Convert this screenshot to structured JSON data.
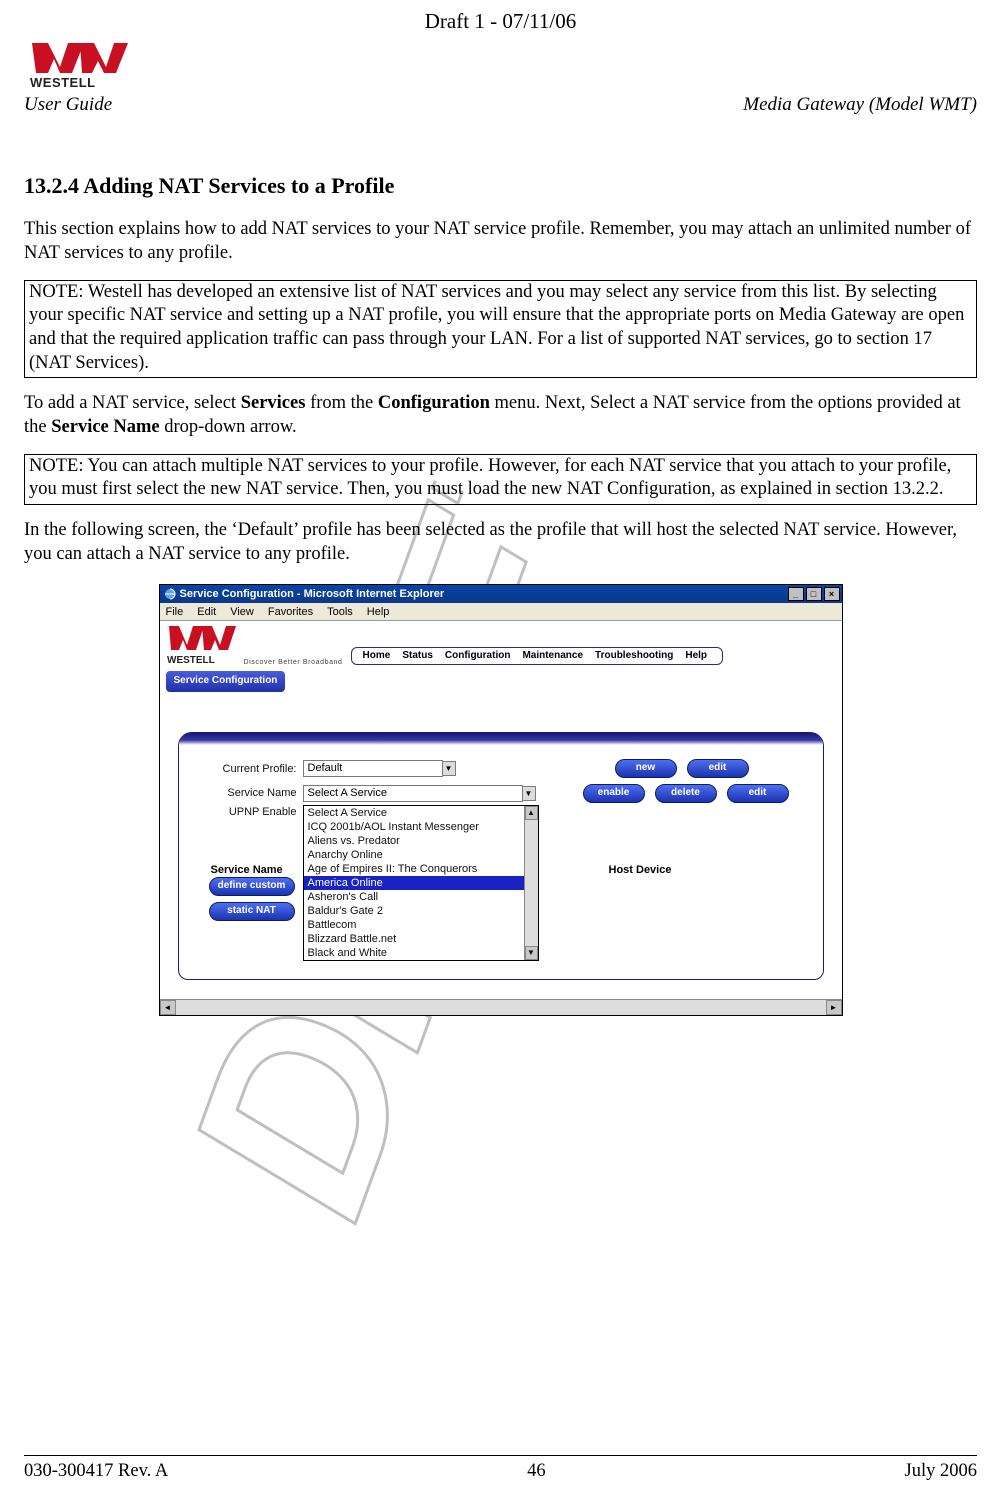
{
  "header": {
    "draft_line": "Draft 1 - 07/11/06",
    "user_guide": "User Guide",
    "product": "Media Gateway (Model WMT)"
  },
  "section": {
    "number": "13.2.4",
    "title": "Adding NAT Services to a Profile",
    "intro": "This section explains how to add NAT services to your NAT service profile. Remember, you may attach an unlimited number of NAT services to any profile.",
    "note1": "NOTE: Westell has developed an extensive list of NAT services and you may select any service from this list. By selecting your specific NAT service and setting up a NAT profile, you will ensure that the appropriate ports on Media Gateway are open and that the required application traffic can pass through your LAN. For a list of supported NAT services, go to section 17 (NAT Services).",
    "instruction_parts": {
      "p1": "To add a NAT service, select ",
      "b1": "Services",
      "p2": " from the ",
      "b2": "Configuration",
      "p3": " menu. Next, Select a NAT service from the options provided at the ",
      "b3": "Service Name",
      "p4": " drop-down arrow."
    },
    "note2": "NOTE: You can attach multiple NAT services to your profile. However, for each NAT service that you attach to your profile, you must first select the new NAT service. Then, you must load the new NAT Configuration, as explained in section 13.2.2.",
    "para_after": "In the following screen, the ‘Default’ profile has been selected as the profile that will host the selected NAT service. However, you can attach a NAT service to any profile."
  },
  "screenshot": {
    "title": "Service Configuration - Microsoft Internet Explorer",
    "menubar": [
      "File",
      "Edit",
      "View",
      "Favorites",
      "Tools",
      "Help"
    ],
    "brand_tag": "Discover Better Broadband",
    "topnav": [
      "Home",
      "Status",
      "Configuration",
      "Maintenance",
      "Troubleshooting",
      "Help"
    ],
    "subnav": "Service Configuration",
    "labels": {
      "current_profile": "Current Profile:",
      "service_name": "Service Name",
      "upnp": "UPNP Enable",
      "header_service_name": "Service Name",
      "header_host": "Host Device"
    },
    "profile_value": "Default",
    "service_value": "Select A Service",
    "dropdown": [
      "Select A Service",
      "ICQ 2001b/AOL Instant Messenger",
      "Aliens vs. Predator",
      "Anarchy Online",
      "Age of Empires II: The Conquerors",
      "America Online",
      "Asheron's Call",
      "Baldur's Gate 2",
      "Battlecom",
      "Blizzard Battle.net",
      "Black and White"
    ],
    "buttons": {
      "new": "new",
      "edit": "edit",
      "enable": "enable",
      "delete": "delete",
      "define_custom": "define custom",
      "static_nat": "static NAT"
    }
  },
  "footer": {
    "left": "030-300417 Rev. A",
    "center": "46",
    "right": "July 2006"
  }
}
